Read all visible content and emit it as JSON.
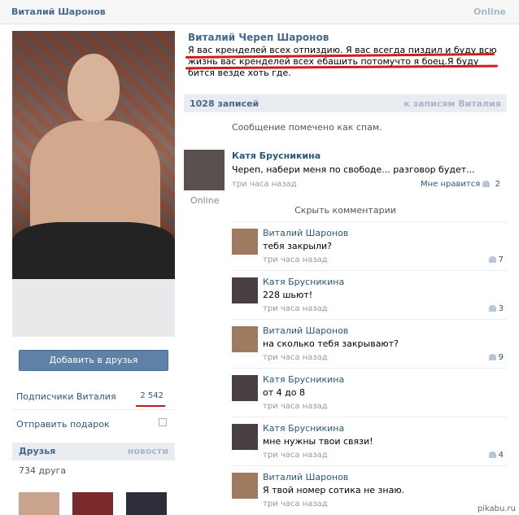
{
  "topbar": {
    "name": "Виталий Шаронов",
    "status": "Online"
  },
  "profile": {
    "add_friend": "Добавить в друзья",
    "subscribers_label": "Подписчики Виталия",
    "subscribers_count": "2 542",
    "gift_label": "Отправить подарок",
    "friends_title": "Друзья",
    "friends_news": "новости",
    "friends_count": "734 друга"
  },
  "status": {
    "name": "Виталий Череп Шаронов",
    "text": "Я вас кренделей всех отпиздию. Я вас всегда пиздил и буду всю жизнь вас кренделей всех ебашить потомучто я боец.Я буду бится везде хоть где."
  },
  "wall": {
    "count": "1028 записей",
    "link": "к записям Виталия",
    "spam": "Сообщение помечено как спам.",
    "post": {
      "author": "Катя Брусникина",
      "text": "Череп, набери меня по свободе... разговор будет...",
      "time": "три часа назад",
      "likes_label": "Мне нравится",
      "likes": "2",
      "online": "Online"
    },
    "hide_comments": "Скрыть комментарии",
    "comments": [
      {
        "author": "Виталий Шаронов",
        "text": "тебя закрыли?",
        "time": "три часа назад",
        "likes": "7"
      },
      {
        "author": "Катя Брусникина",
        "text": "228 шьют!",
        "time": "три часа назад",
        "likes": "3"
      },
      {
        "author": "Виталий Шаронов",
        "text": "на сколько тебя закрывают?",
        "time": "три часа назад",
        "likes": "9"
      },
      {
        "author": "Катя Брусникина",
        "text": "от 4 до 8",
        "time": "три часа назад",
        "likes": ""
      },
      {
        "author": "Катя Брусникина",
        "text": "мне нужны твои связи!",
        "time": "три часа назад",
        "likes": "4"
      },
      {
        "author": "Виталий Шаронов",
        "text": "Я твой номер сотика не знаю.",
        "time": "три часа назад",
        "likes": ""
      }
    ]
  },
  "watermark": "pikabu.ru"
}
